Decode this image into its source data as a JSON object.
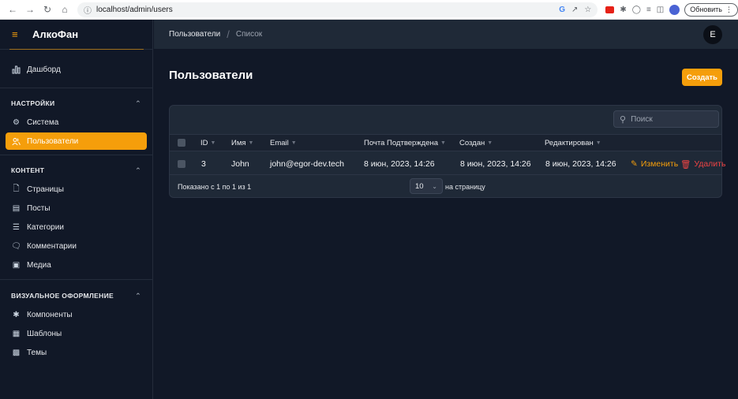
{
  "browser": {
    "url": "localhost/admin/users",
    "update_label": "Обновить"
  },
  "sidebar": {
    "brand": "АлкоФан",
    "dashboard": "Дашборд",
    "sections": [
      {
        "title": "НАСТРОЙКИ",
        "items": [
          "Система",
          "Пользователи"
        ]
      },
      {
        "title": "КОНТЕНТ",
        "items": [
          "Страницы",
          "Посты",
          "Категории",
          "Комментарии",
          "Медиа"
        ]
      },
      {
        "title": "ВИЗУАЛЬНОЕ ОФОРМЛЕНИЕ",
        "items": [
          "Компоненты",
          "Шаблоны",
          "Темы"
        ]
      }
    ],
    "active_item": "Пользователи"
  },
  "header": {
    "breadcrumb": [
      "Пользователи",
      "Список"
    ],
    "avatar_initial": "E"
  },
  "main": {
    "title": "Пользователи",
    "create_label": "Создать",
    "search_placeholder": "Поиск",
    "table": {
      "columns": [
        "ID",
        "Имя",
        "Email",
        "Почта Подтверждена",
        "Создан",
        "Редактирован"
      ],
      "rows": [
        {
          "id": "3",
          "name": "John",
          "email": "john@egor-dev.tech",
          "verified": "8 июн, 2023, 14:26",
          "created": "8 июн, 2023, 14:26",
          "updated": "8 июн, 2023, 14:26"
        }
      ],
      "edit_label": "Изменить",
      "delete_label": "Удалить"
    },
    "pagination": {
      "summary": "Показано с 1 по 1 из 1",
      "per_page": "10",
      "per_page_label": "на страницу"
    }
  },
  "colors": {
    "accent": "#f59e0b",
    "danger": "#ef4444",
    "background": "#111827",
    "surface": "#1f2937"
  }
}
